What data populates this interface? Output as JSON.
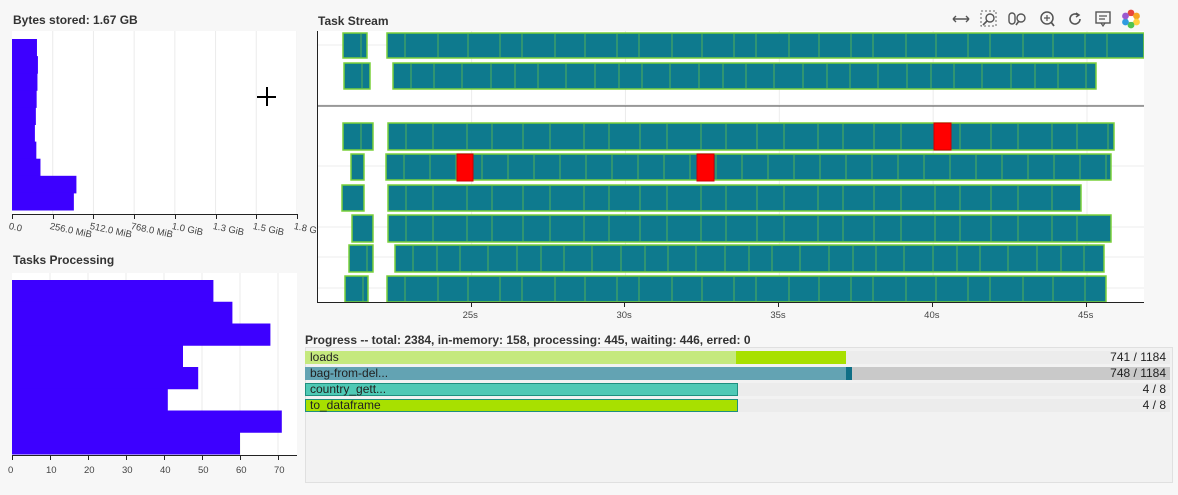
{
  "bytes_stored": {
    "title": "Bytes stored: 1.67 GB",
    "x_ticks": [
      "0.0",
      "256.0 MiB",
      "512.0 MiB",
      "768.0 MiB",
      "1.0 GiB",
      "1.3 GiB",
      "1.5 GiB",
      "1.8 G"
    ],
    "bar_color": "#3d00ff"
  },
  "tasks_processing": {
    "title": "Tasks Processing",
    "x_ticks": [
      "0",
      "10",
      "20",
      "30",
      "40",
      "50",
      "60",
      "70"
    ],
    "bar_color": "#3d00ff"
  },
  "task_stream": {
    "title": "Task Stream",
    "x_ticks": [
      "25s",
      "30s",
      "35s",
      "40s",
      "45s"
    ],
    "colors": {
      "task": "#0e7a8e",
      "border": "#7ad03a",
      "error": "#ff0000"
    }
  },
  "toolbar": {
    "tools": [
      "pan-icon",
      "box-zoom-icon",
      "wheel-zoom-icon",
      "zoom-in-icon",
      "reset-icon",
      "hover-icon",
      "bokeh-logo-icon"
    ]
  },
  "progress": {
    "title": "Progress -- total: 2384, in-memory: 158, processing: 445, waiting: 446, erred: 0",
    "rows": [
      {
        "name": "loads",
        "count": "741 / 1184",
        "colors": [
          "#c5e97e",
          "#a8e000"
        ],
        "fracs": [
          0.498,
          0.128,
          0.004
        ]
      },
      {
        "name": "bag-from-del...",
        "count": "748 / 1184",
        "colors": [
          "#63a3b3",
          "#0f6f86"
        ],
        "fracs": [
          0.626,
          0.006,
          0.0
        ]
      },
      {
        "name": "country_gett...",
        "count": "4 / 8",
        "colors": [
          "#4fc9b5",
          "#2fa89a"
        ],
        "fracs": [
          0.5,
          0.0,
          0.0
        ]
      },
      {
        "name": "to_dataframe",
        "count": "4 / 8",
        "colors": [
          "#a8e000",
          "#8fc400"
        ],
        "fracs": [
          0.5,
          0.0,
          0.0
        ]
      }
    ]
  },
  "chart_data": [
    {
      "type": "bar",
      "title": "Bytes stored: 1.67 GB",
      "orientation": "horizontal",
      "x_unit": "MiB",
      "xlim": [
        0,
        1792
      ],
      "series": [
        {
          "values": [
            157,
            163,
            160,
            155,
            150,
            144,
            153,
            179,
            405,
            389
          ]
        }
      ]
    },
    {
      "type": "bar",
      "title": "Tasks Processing",
      "orientation": "horizontal",
      "xlim": [
        0,
        75
      ],
      "series": [
        {
          "values": [
            53,
            58,
            68,
            45,
            49,
            41,
            71,
            60
          ]
        }
      ]
    }
  ]
}
